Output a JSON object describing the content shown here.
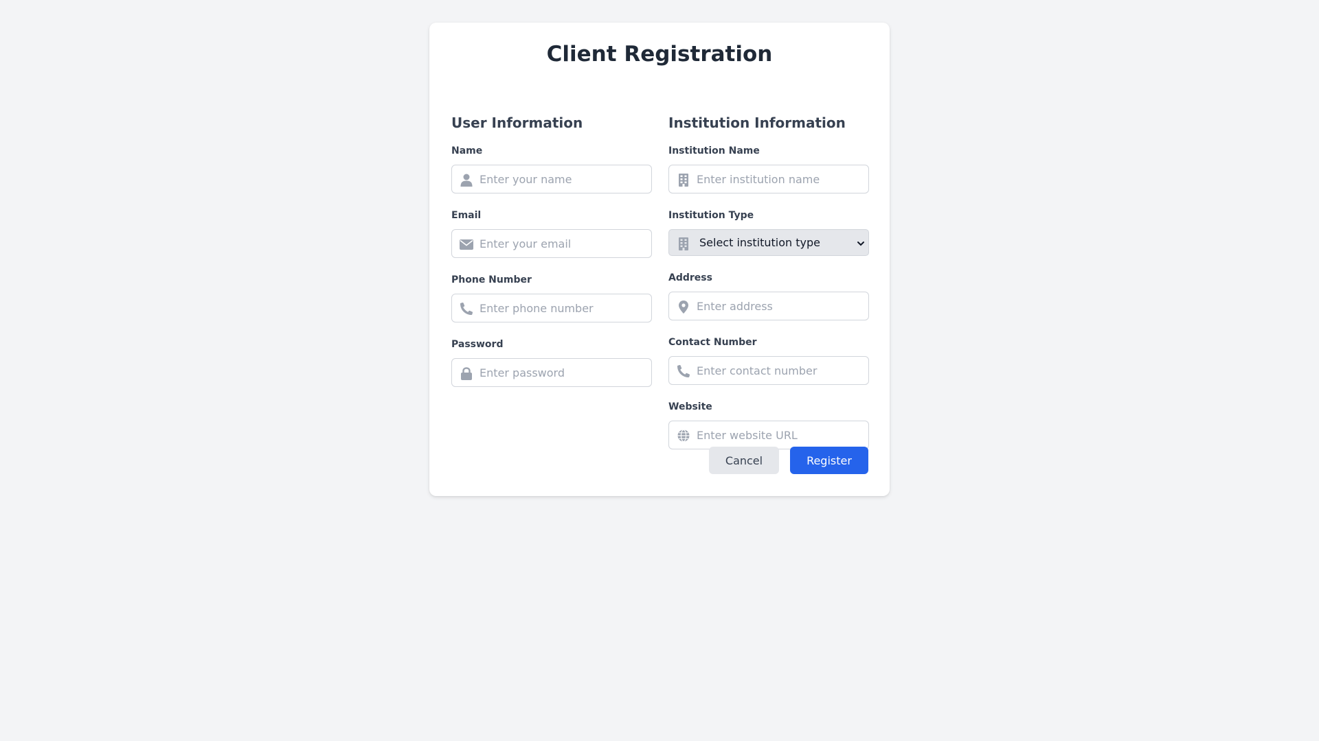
{
  "page": {
    "title": "Client Registration"
  },
  "user_section": {
    "heading": "User Information",
    "fields": [
      {
        "label": "Name",
        "placeholder": "Enter your name",
        "icon": "user-icon"
      },
      {
        "label": "Email",
        "placeholder": "Enter your email",
        "icon": "envelope-icon"
      },
      {
        "label": "Phone Number",
        "placeholder": "Enter phone number",
        "icon": "phone-icon"
      },
      {
        "label": "Password",
        "placeholder": "Enter password",
        "icon": "lock-icon"
      }
    ]
  },
  "institution_section": {
    "heading": "Institution Information",
    "name_field": {
      "label": "Institution Name",
      "placeholder": "Enter institution name",
      "icon": "building-icon"
    },
    "type_field": {
      "label": "Institution Type",
      "selected": "Select institution type",
      "icon": "building-icon"
    },
    "address_field": {
      "label": "Address",
      "placeholder": "Enter address",
      "icon": "map-pin-icon"
    },
    "contact_field": {
      "label": "Contact Number",
      "placeholder": "Enter contact number",
      "icon": "phone-icon"
    },
    "website_field": {
      "label": "Website",
      "placeholder": "Enter website URL",
      "icon": "globe-icon"
    }
  },
  "actions": {
    "cancel_label": "Cancel",
    "register_label": "Register"
  },
  "colors": {
    "background": "#f3f4f6",
    "card": "#ffffff",
    "primary": "#2563eb",
    "secondary_button": "#e5e7eb",
    "icon": "#9ca3af"
  }
}
